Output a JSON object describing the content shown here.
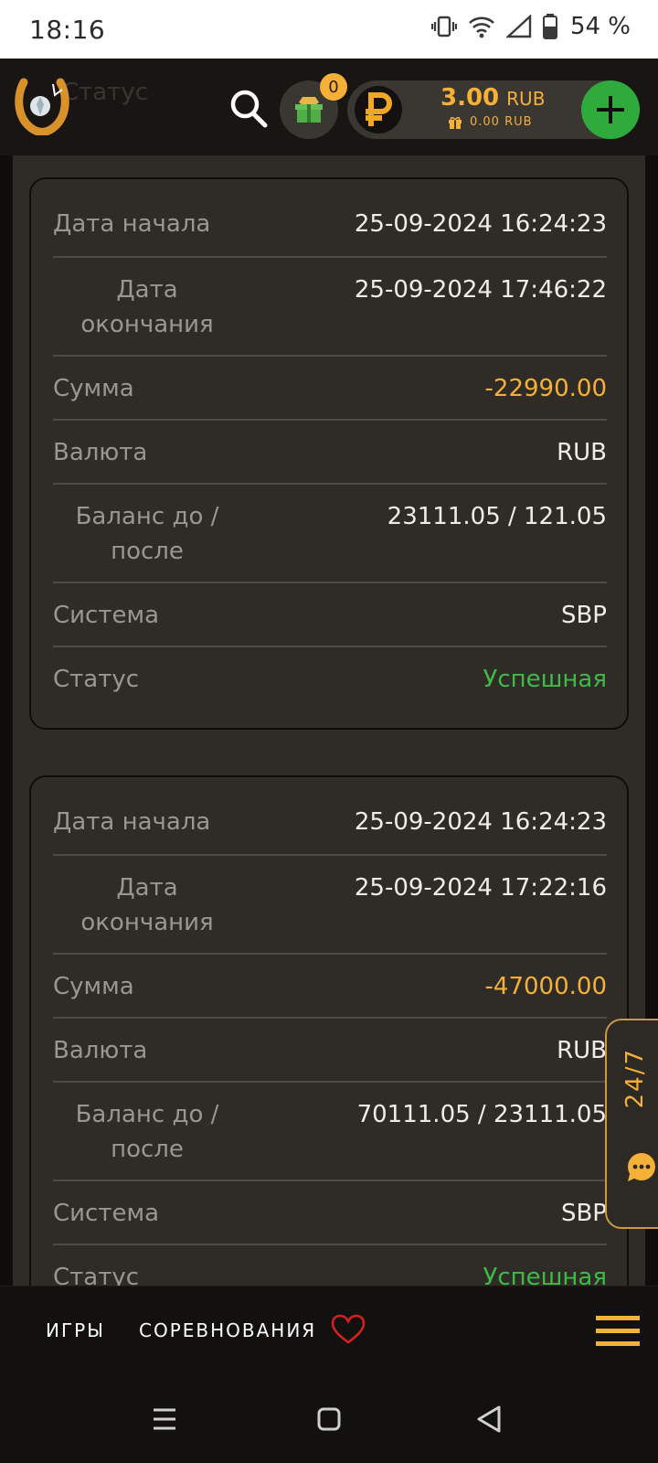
{
  "status_bar": {
    "time": "18:16",
    "battery": "54 %"
  },
  "header": {
    "ghost_text": "Статус",
    "gift_count": "0",
    "balance_amount": "3.00",
    "balance_currency": "RUB",
    "bonus_balance": "0.00 RUB"
  },
  "cards": [
    {
      "rows": [
        {
          "label": "Дата начала",
          "value": "25-09-2024 16:24:23"
        },
        {
          "label": "Дата окончания",
          "value": "25-09-2024 17:46:22"
        },
        {
          "label": "Сумма",
          "value": "-22990.00"
        },
        {
          "label": "Валюта",
          "value": "RUB"
        },
        {
          "label": "Баланс до / после",
          "value": "23111.05 / 121.05"
        },
        {
          "label": "Система",
          "value": "SBP"
        },
        {
          "label": "Статус",
          "value": "Успешная"
        }
      ]
    },
    {
      "rows": [
        {
          "label": "Дата начала",
          "value": "25-09-2024 16:24:23"
        },
        {
          "label": "Дата окончания",
          "value": "25-09-2024 17:22:16"
        },
        {
          "label": "Сумма",
          "value": "-47000.00"
        },
        {
          "label": "Валюта",
          "value": "RUB"
        },
        {
          "label": "Баланс до / после",
          "value": "70111.05 / 23111.05"
        },
        {
          "label": "Система",
          "value": "SBP"
        },
        {
          "label": "Статус",
          "value": "Успешная"
        }
      ]
    }
  ],
  "chat_tab": {
    "label": "24/7"
  },
  "bottom_nav": {
    "games": "ИГРЫ",
    "competitions": "СОРЕВНОВАНИЯ"
  },
  "colors": {
    "accent": "#f5b038",
    "success": "#3fba48",
    "add_button": "#2eab3c",
    "panel": "#2f2c28"
  }
}
